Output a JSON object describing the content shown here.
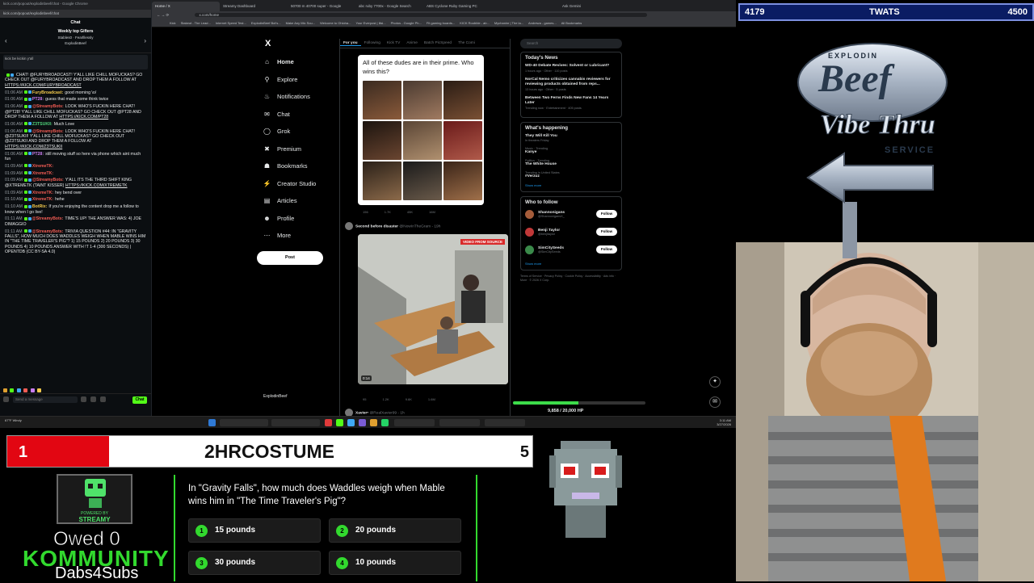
{
  "chat": {
    "window_title": "kick.com/popout/explodinbeef/chat - Google Chrome",
    "url": "kick.com/popout/explodinbeef/chat",
    "title": "Chat",
    "weekly_gifters_title": "Weekly top Gifters",
    "gifter_1": "Stables0",
    "gifter_2": "Fearlllessly",
    "gifter_3": "ExplodinBeef",
    "pinned_1": "kick be kickin y'all",
    "input_placeholder": "Send a message",
    "chat_button": "Chat",
    "messages": [
      {
        "time": "",
        "user": "",
        "text": "CHAT! @FURYBROADCAST! Y'ALL LIKE CHILL MOFUCKAS? GO CHECK OUT @FURYBROADCAST AND DROP THEM A FOLLOW AT",
        "link": "HTTPS://KICK.COM/FURYBROADCAST",
        "color": "#e7e9ea"
      },
      {
        "time": "01:06 AM",
        "user": "FuryBroadcast:",
        "text": "good morning \\o/",
        "link": "",
        "color": "#f2c94c"
      },
      {
        "time": "01:06 AM",
        "user": "PT28:",
        "text": "guess that made some think twice",
        "link": "",
        "color": "#c97df0"
      },
      {
        "time": "01:06 AM",
        "user": "@StreamyBots:",
        "text": "LOOK WHO'S FUCKIN HERE CHAT! @PT28! Y'ALL LIKE CHILL MOFUCKAS? GO CHECK OUT @PT28 AND DROP THEM A FOLLOW AT",
        "link": "HTTPS://KICK.COM/PT28",
        "color": "#f25c54"
      },
      {
        "time": "01:06 AM",
        "user": "Z3TSUKII:",
        "text": "Much Love",
        "link": "",
        "color": "#4fd27a"
      },
      {
        "time": "01:06 AM",
        "user": "@StreamyBots:",
        "text": "LOOK WHO'S FUCKIN HERE CHAT! @Z3TSUKII! Y'ALL LIKE CHILL MOFUCKAS? GO CHECK OUT @Z3TSUKII AND DROP THEM A FOLLOW AT",
        "link": "HTTPS://KICK.COM/Z3TSUKII",
        "color": "#f25c54"
      },
      {
        "time": "01:06 AM",
        "user": "PT28:",
        "text": "still moving stuff so here via phone which aint much fun",
        "link": "",
        "color": "#c97df0"
      },
      {
        "time": "01:09 AM",
        "user": "XtremeTK:",
        "text": "",
        "link": "",
        "color": "#f25c54"
      },
      {
        "time": "01:09 AM",
        "user": "XtremeTK:",
        "text": "",
        "link": "",
        "color": "#f25c54"
      },
      {
        "time": "01:09 AM",
        "user": "@StreamyBots:",
        "text": "Y'ALL ITS THE THIRD SHIFT KING @XTREMETK (TAINT KISSER)",
        "link": "HTTPS://KICK.COM/XTREMETK",
        "color": "#f25c54"
      },
      {
        "time": "01:09 AM",
        "user": "XtremeTK:",
        "text": "hey bend over",
        "link": "",
        "color": "#f25c54"
      },
      {
        "time": "01:10 AM",
        "user": "XtremeTK:",
        "text": "hehe",
        "link": "",
        "color": "#f25c54"
      },
      {
        "time": "01:10 AM",
        "user": "BotRix:",
        "text": "If you're enjoying the content drop me a follow to know when I go live!",
        "link": "",
        "color": "#f2c94c"
      },
      {
        "time": "01:11 AM",
        "user": "@StreamyBots:",
        "text": "TIME'S UP! THE ANSWER WAS: 4) JOE DIMAGGIO",
        "link": "",
        "color": "#f25c54"
      },
      {
        "time": "01:11 AM",
        "user": "@StreamyBots:",
        "text": "TRIVIA QUESTION #44: IN \"GRAVITY FALLS\", HOW MUCH DOES WADDLES WEIGH WHEN MABLE WINS HIM IN \"THE TIME TRAVELER'S PIG\"? 1) 15 POUNDS 2) 20 POUNDS 3) 30 POUNDS 4) 10 POUNDS ANSWER WITH !T 1-4 (300 SECONDS) | OPENTDB (CC BY-SA 4.0)",
        "link": "",
        "color": "#f25c54"
      }
    ]
  },
  "browser": {
    "tabs": [
      "Home / X",
      "Streamy Dashboard",
      "50700 m 40700 super - Google",
      "abc ruby 7700x - Google Search",
      "ABS Cyclone Ruby Gaming PC",
      "",
      "Ask Gemini"
    ],
    "url": "x.com/home",
    "bookmarks": [
      "Kick",
      "Stakeut - The Lead...",
      "Internet Speed Test...",
      "ExplodinBeef Bot's...",
      "Make Any Mic Sou...",
      "Welcome to Ohioha...",
      "Your Everpost | lilsi...",
      "Photos - Google Ph...",
      "Fit gaming boards...",
      "KICK Roobble - ab...",
      "Mychaninr | The la...",
      "Andrewa - games...",
      "All Bookmarks"
    ]
  },
  "xnav": {
    "logo": "X",
    "items": [
      "Home",
      "Explore",
      "Notifications",
      "Chat",
      "Grok",
      "Premium",
      "Bookmarks",
      "Creator Studio",
      "Articles",
      "Profile",
      "More"
    ],
    "post_button": "Post",
    "account": "ExplodinBeef"
  },
  "feed": {
    "tabs": [
      "For you",
      "Following",
      "Kick TV",
      "Anime",
      "Batch PicSpeed",
      "The Comi"
    ],
    "quote_text": "All of these dudes are in their prime. Who wins this?",
    "post1_actions": [
      "156",
      "1.7K",
      "45K",
      "16M"
    ],
    "post2_user": "Second before disaster",
    "post2_handle": "@NowInTheGram - 19h",
    "video_badge": "VIDEO FROM SOURCE",
    "video_duration": "0:14",
    "post2_actions": [
      "95",
      "1.2K",
      "9.6K",
      "1.6M"
    ],
    "post3_user": "Xavier•",
    "post3_handle": "@RealXavier99 - 1h"
  },
  "side": {
    "search_placeholder": "Search",
    "news_title": "Today's News",
    "news": [
      {
        "title": "WD-40 Debate Revives: Solvent or Lubricant?",
        "meta": "1 hours ago · Other · 110 posts"
      },
      {
        "title": "NorCal Nemo criticizes cannabis reviewers for reviewing products obtained from reps...",
        "meta": "13 hours ago · Other · 5 posts"
      },
      {
        "title": "Between Two Ferns Finds New Fans 14 Years Later",
        "meta": "Trending now · Entertainment · 405 posts"
      }
    ],
    "happening_title": "What's happening",
    "trends": [
      {
        "cat": "They Will Kill You",
        "sub": "In theaters Friday",
        "name": ""
      },
      {
        "cat": "Music · Trending",
        "sub": "",
        "name": "Kanye"
      },
      {
        "cat": "Politics · Trending",
        "sub": "",
        "name": "The White House"
      },
      {
        "cat": "Trending in United States",
        "sub": "",
        "name": "#Verzuz"
      }
    ],
    "show_more": "Show more",
    "who_title": "Who to follow",
    "follows": [
      {
        "name": "Shannonigans",
        "handle": "@ShannonigansX_"
      },
      {
        "name": "Benji Taylor",
        "handle": "@benjitaylor"
      },
      {
        "name": "SimCitySeeds",
        "handle": "@SimCitySeeds"
      }
    ],
    "follow_label": "Follow",
    "footer": "Terms of Service · Privacy Policy · Cookie Policy · Accessibility · Ads info · More · © 2026 X Corp."
  },
  "progress": {
    "text": "9,858 / 20,000 HP",
    "fraction": 0.4929
  },
  "taskbar": {
    "weather": "67°F Windy",
    "time": "3:11 AM",
    "date": "3/27/2026"
  },
  "overlay": {
    "left_count": "4179",
    "center_label": "TWATS",
    "right_count": "4500",
    "logo_top": "EXPLODIN",
    "logo_main": "Beef",
    "logo_sub": "Vibe Thru",
    "logo_service": "SERVICE"
  },
  "countbar": {
    "left": "1",
    "name": "2HRCOSTUME",
    "right": "5"
  },
  "streamy": {
    "powered": "POWERED BY",
    "name": "STREAMY"
  },
  "owed": "Owed 0",
  "kommunity": "KOMMUNITY",
  "dabs": "Dabs4Subs",
  "trivia": {
    "question": "In \"Gravity Falls\", how much does Waddles weigh when Mable wins him in \"The Time Traveler's Pig\"?",
    "options": [
      {
        "num": "1",
        "text": "15 pounds"
      },
      {
        "num": "2",
        "text": "20 pounds"
      },
      {
        "num": "3",
        "text": "30 pounds"
      },
      {
        "num": "4",
        "text": "10 pounds"
      }
    ]
  }
}
